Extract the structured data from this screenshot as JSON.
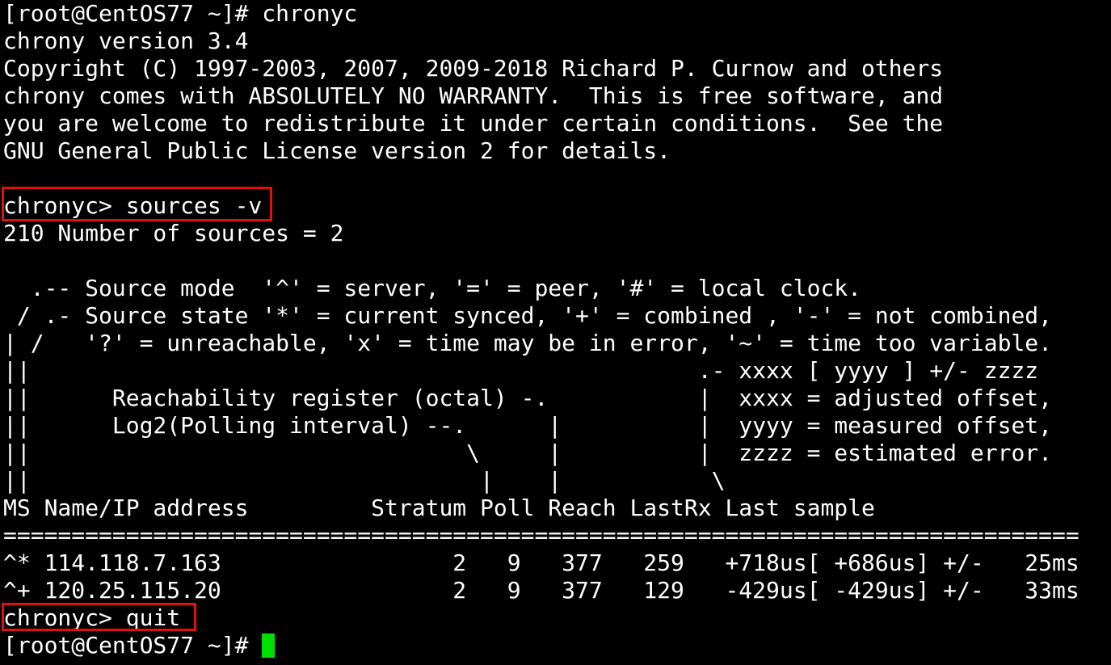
{
  "terminal": {
    "lines": [
      "[root@CentOS77 ~]# chronyc",
      "chrony version 3.4",
      "Copyright (C) 1997-2003, 2007, 2009-2018 Richard P. Curnow and others",
      "chrony comes with ABSOLUTELY NO WARRANTY.  This is free software, and",
      "you are welcome to redistribute it under certain conditions.  See the",
      "GNU General Public License version 2 for details.",
      "",
      "chronyc> sources -v",
      "210 Number of sources = 2",
      "",
      "  .-- Source mode  '^' = server, '=' = peer, '#' = local clock.",
      " / .- Source state '*' = current synced, '+' = combined , '-' = not combined,",
      "| /   '?' = unreachable, 'x' = time may be in error, '~' = time too variable.",
      "||                                                 .- xxxx [ yyyy ] +/- zzzz",
      "||      Reachability register (octal) -.           |  xxxx = adjusted offset,",
      "||      Log2(Polling interval) --.      |          |  yyyy = measured offset,",
      "||                                \\     |          |  zzzz = estimated error.",
      "||                                 |    |           \\",
      "MS Name/IP address         Stratum Poll Reach LastRx Last sample",
      "===============================================================================",
      "^* 114.118.7.163                 2   9   377   259   +718us[ +686us] +/-   25ms",
      "^+ 120.25.115.20                 2   9   377   129   -429us[ -429us] +/-   33ms",
      "chronyc> quit"
    ],
    "final_prompt": "[root@CentOS77 ~]# ",
    "cursor_color": "#00e000",
    "highlight_color": "#e01010"
  }
}
